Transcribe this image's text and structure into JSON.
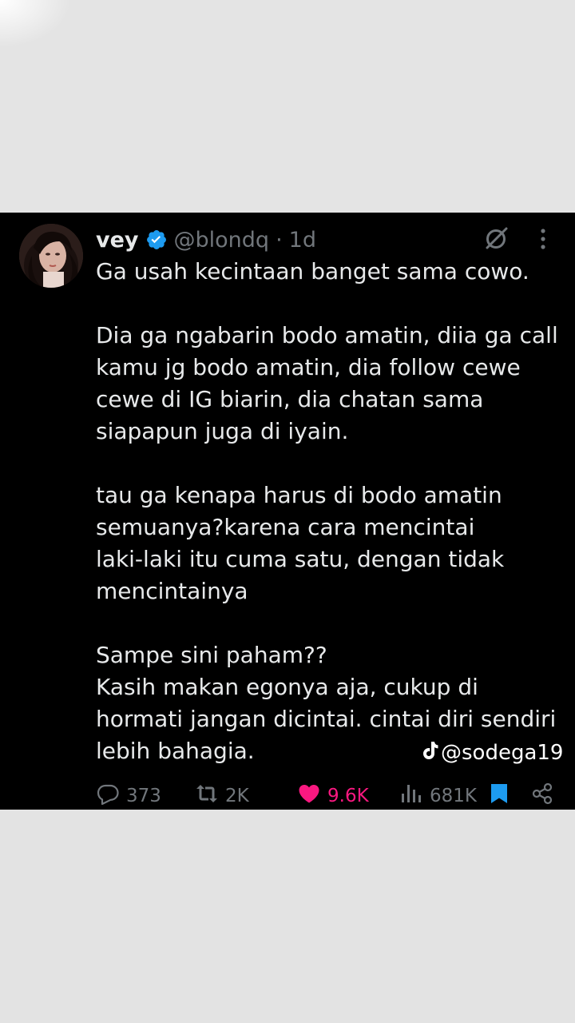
{
  "tweet": {
    "display_name": "vey",
    "handle": "@blondq",
    "separator": "·",
    "time": "1d",
    "paragraphs": [
      [
        "Ga usah kecintaan banget sama cowo."
      ],
      [
        "Dia ga ngabarin bodo amatin, diia ga call",
        "kamu jg bodo amatin, dia follow cewe",
        "cewe di IG biarin, dia chatan sama",
        "siapapun juga di iyain."
      ],
      [
        "tau ga kenapa harus di bodo amatin",
        "semuanya?karena cara mencintai",
        "laki-laki itu cuma satu, dengan tidak",
        "mencintainya"
      ],
      [
        "Sampe sini paham??",
        "Kasih makan egonya aja, cukup di",
        "hormati jangan dicintai. cintai diri sendiri",
        "lebih bahagia."
      ]
    ]
  },
  "actions": {
    "replies": "373",
    "reposts": "2K",
    "likes": "9.6K",
    "views": "681K"
  },
  "watermark": {
    "text": "@sodega19"
  },
  "icons": {
    "verified": "verified-badge-icon",
    "grok": "grok-icon",
    "more": "more-vertical-icon",
    "reply": "reply-icon",
    "repost": "repost-icon",
    "like": "heart-icon",
    "views": "views-icon",
    "bookmark": "bookmark-icon",
    "share": "share-icon",
    "tiktok": "tiktok-icon"
  },
  "colors": {
    "background": "#000000",
    "text": "#e7e9ea",
    "muted": "#71767b",
    "verified": "#1d9bf0",
    "like": "#f91880",
    "bookmark": "#1d9bf0"
  }
}
